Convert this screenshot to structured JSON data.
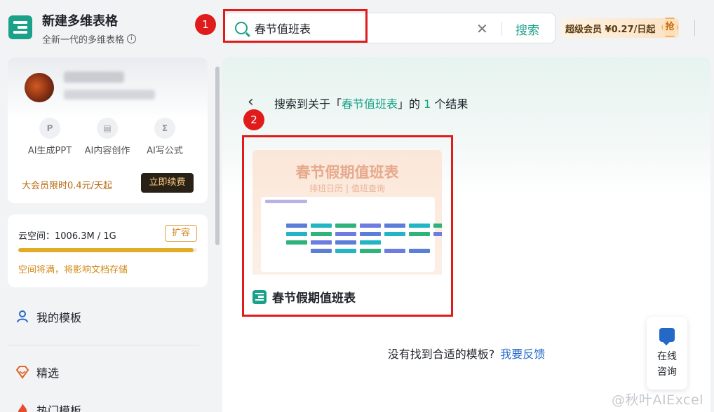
{
  "app": {
    "title": "新建多维表格",
    "subtitle": "全新一代的多维表格",
    "info_icon": "ⓘ"
  },
  "search": {
    "value": "春节值班表",
    "clear_icon": "✕",
    "button_label": "搜索"
  },
  "annotations": {
    "step1": "1",
    "step2": "2"
  },
  "vip": {
    "label": "超级会员 ¥0.27/日起",
    "grab_label": "抢"
  },
  "user_card": {
    "ai_tools": [
      {
        "label": "AI生成PPT",
        "icon": "ppt-icon"
      },
      {
        "label": "AI内容创作",
        "icon": "doc-icon"
      },
      {
        "label": "AI写公式",
        "icon": "formula-icon"
      }
    ],
    "promo_text": "大会员限时0.4元/天起",
    "renew_label": "立即续费"
  },
  "storage": {
    "label": "云空间：1006.3M / 1G",
    "expand_label": "扩容",
    "usage_fraction": 0.98,
    "warning": "空间将满，将影响文档存储",
    "bar_color": "#e2ad26"
  },
  "nav": {
    "my_templates": "我的模板",
    "featured": "精选",
    "hot_templates": "热门模板"
  },
  "results": {
    "prefix": "搜索到关于「",
    "keyword": "春节值班表",
    "middle": "」的 ",
    "count": "1",
    "suffix": " 个结果",
    "items": [
      {
        "name": "春节假期值班表",
        "thumb_title": "春节假期值班表",
        "thumb_subtitle": "排班日历 | 值班查询"
      }
    ]
  },
  "feedback": {
    "text": "没有找到合适的模板?",
    "link": "我要反馈"
  },
  "support": {
    "label": "在线\n咨询"
  },
  "watermark": "@秋叶AIExcel",
  "colors": {
    "accent": "#1aa189",
    "highlight_box": "#e01b1b",
    "link": "#2468c8"
  }
}
